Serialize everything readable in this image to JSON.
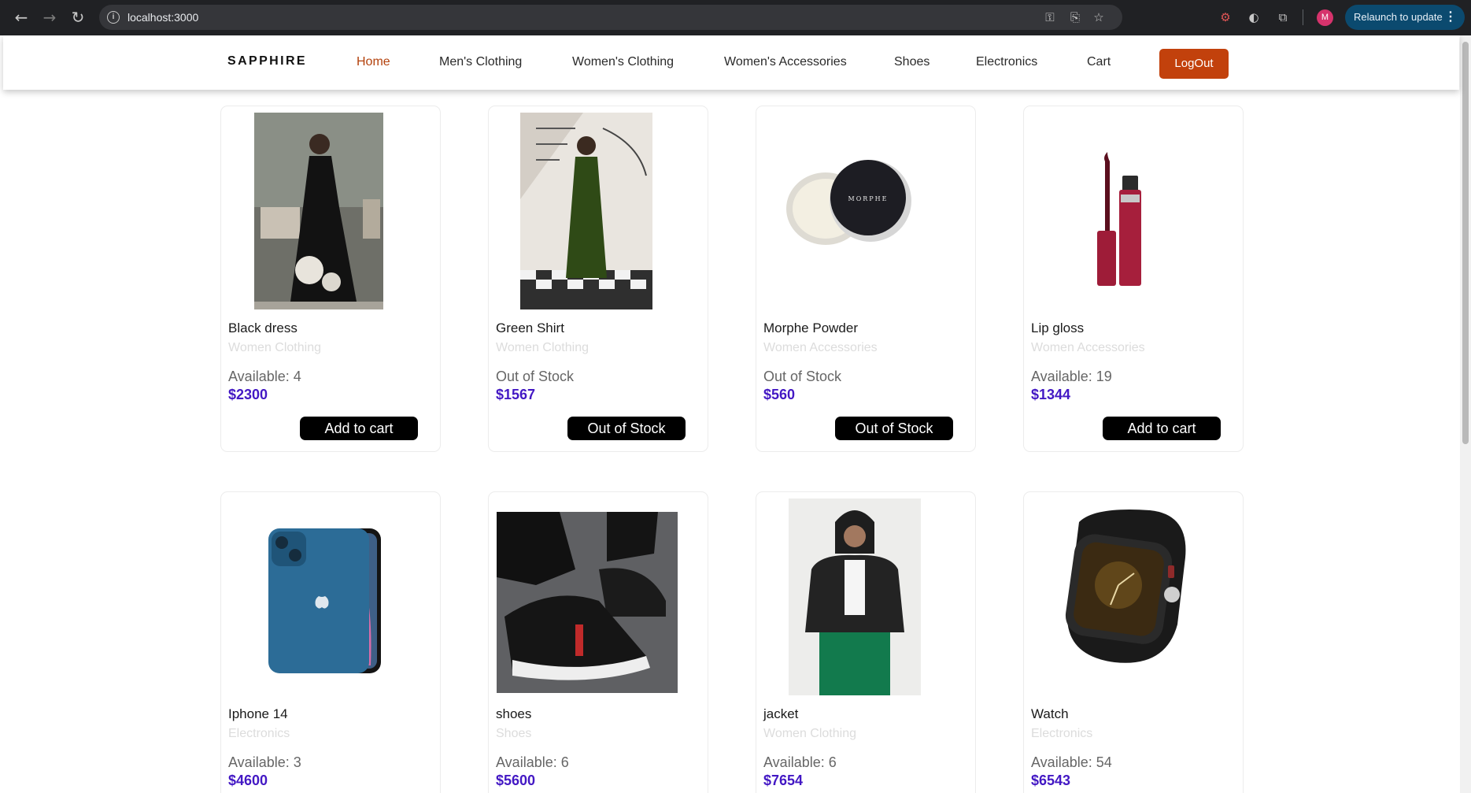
{
  "browser": {
    "url": "localhost:3000",
    "profile_initial": "M",
    "relaunch_label": "Relaunch to update"
  },
  "site": {
    "brand": "SAPPHIRE",
    "nav": [
      {
        "label": "Home"
      },
      {
        "label": "Men's Clothing"
      },
      {
        "label": "Women's Clothing"
      },
      {
        "label": "Women's Accessories"
      },
      {
        "label": "Shoes"
      },
      {
        "label": "Electronics"
      },
      {
        "label": "Cart"
      }
    ],
    "logout_label": "LogOut",
    "colors": {
      "accent": "#c2410c",
      "price": "#4318c4",
      "button": "#000000"
    }
  },
  "products": [
    {
      "name": "Black dress",
      "category": "Women Clothing",
      "stock": "Available: 4",
      "price": "$2300",
      "button": "Add to cart",
      "image": "black-dress-photo"
    },
    {
      "name": "Green Shirt",
      "category": "Women Clothing",
      "stock": "Out of Stock",
      "price": "$1567",
      "button": "Out of Stock",
      "image": "green-shirt-photo"
    },
    {
      "name": "Morphe Powder",
      "category": "Women Accessories",
      "stock": "Out of Stock",
      "price": "$560",
      "button": "Out of Stock",
      "image": "powder-compact-photo"
    },
    {
      "name": "Lip gloss",
      "category": "Women Accessories",
      "stock": "Available: 19",
      "price": "$1344",
      "button": "Add to cart",
      "image": "lip-gloss-photo"
    },
    {
      "name": "Iphone 14",
      "category": "Electronics",
      "stock": "Available: 3",
      "price": "$4600",
      "image": "iphone-photo"
    },
    {
      "name": "shoes",
      "category": "Shoes",
      "stock": "Available: 6",
      "price": "$5600",
      "image": "sneaker-photo"
    },
    {
      "name": "jacket",
      "category": "Women Clothing",
      "stock": "Available: 6",
      "price": "$7654",
      "image": "jacket-photo"
    },
    {
      "name": "Watch",
      "category": "Electronics",
      "stock": "Available: 54",
      "price": "$6543",
      "image": "smartwatch-photo"
    }
  ],
  "image_labels": {
    "powder_brand": "MORPHE"
  }
}
